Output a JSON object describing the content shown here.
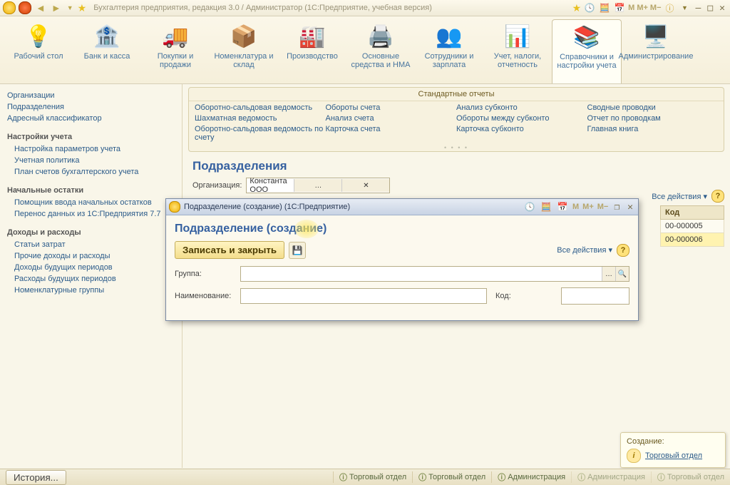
{
  "titlebar": {
    "text": "Бухгалтерия предприятия, редакция 3.0 / Администратор   (1С:Предприятие, учебная версия)",
    "m": "M",
    "mplus": "M+",
    "mminus": "M−"
  },
  "bigButtons": [
    {
      "label": "Рабочий стол"
    },
    {
      "label": "Банк и касса"
    },
    {
      "label": "Покупки и продажи"
    },
    {
      "label": "Номенклатура и склад"
    },
    {
      "label": "Производство"
    },
    {
      "label": "Основные средства и НМА"
    },
    {
      "label": "Сотрудники и зарплата"
    },
    {
      "label": "Учет, налоги, отчетность"
    },
    {
      "label": "Справочники и настройки учета"
    },
    {
      "label": "Администрирование"
    }
  ],
  "sidebar": {
    "top": [
      "Организации",
      "Подразделения",
      "Адресный классификатор"
    ],
    "groups": [
      {
        "title": "Настройки учета",
        "items": [
          "Настройка параметров учета",
          "Учетная политика",
          "План счетов бухгалтерского учета"
        ]
      },
      {
        "title": "Начальные остатки",
        "items": [
          "Помощник ввода начальных остатков",
          "Перенос данных из 1С:Предприятия 7.7"
        ]
      },
      {
        "title": "Доходы и расходы",
        "items": [
          "Статьи затрат",
          "Прочие доходы и расходы",
          "Доходы будущих периодов",
          "Расходы будущих периодов",
          "Номенклатурные группы"
        ]
      }
    ]
  },
  "reports": {
    "title": "Стандартные отчеты",
    "cols": [
      [
        "Оборотно-сальдовая ведомость",
        "Шахматная ведомость",
        "Оборотно-сальдовая ведомость по счету"
      ],
      [
        "Обороты счета",
        "Анализ счета",
        "Карточка счета"
      ],
      [
        "Анализ субконто",
        "Обороты между субконто",
        "Карточка субконто"
      ],
      [
        "Сводные проводки",
        "Отчет по проводкам",
        "Главная книга"
      ]
    ]
  },
  "page": {
    "title": "Подразделения",
    "org_label": "Организация:",
    "org_value": "Константа ООО",
    "all_actions": "Все действия ▾",
    "list_header": "Код",
    "rows": [
      "00-000005",
      "00-000006"
    ]
  },
  "modal": {
    "wintitle": "Подразделение (создание)  (1С:Предприятие)",
    "heading": "Подразделение (создание)",
    "save": "Записать и закрыть",
    "all_actions": "Все действия ▾",
    "group_label": "Группа:",
    "name_label": "Наименование:",
    "code_label": "Код:"
  },
  "statusbar": {
    "history": "История...",
    "tabs": [
      "Торговый отдел",
      "Торговый отдел",
      "Администрация",
      "Администрация",
      "Торговый отдел"
    ]
  },
  "toast": {
    "title": "Создание:",
    "text": "Торговый отдел"
  }
}
